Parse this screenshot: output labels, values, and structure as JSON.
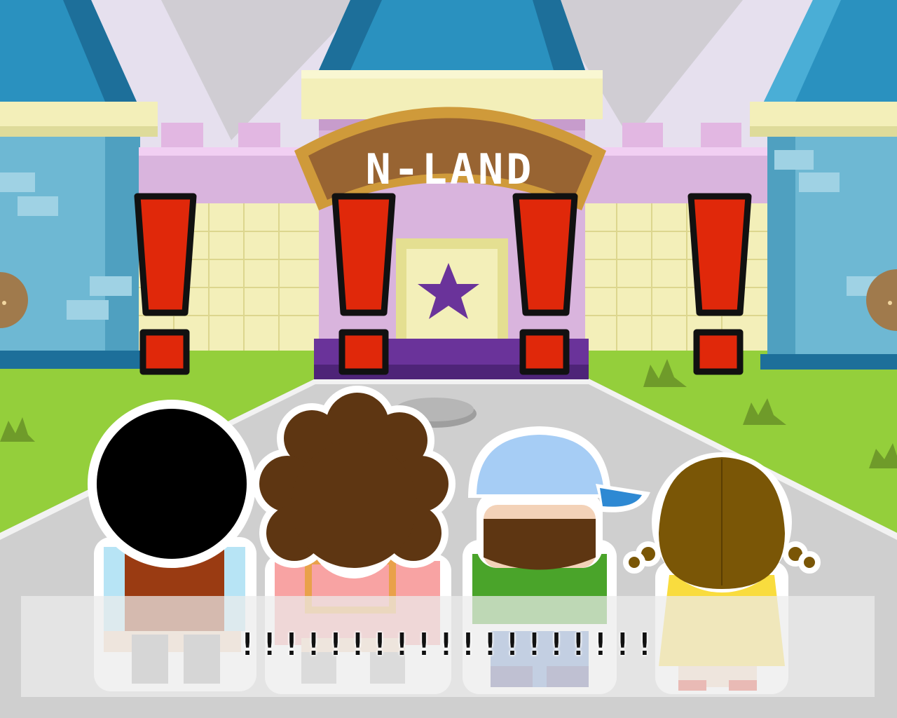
{
  "scene": {
    "sign_text": "N-LAND",
    "exclamation_marks": [
      {
        "id": "alert-1",
        "char": "!"
      },
      {
        "id": "alert-2",
        "char": "!"
      },
      {
        "id": "alert-3",
        "char": "!"
      },
      {
        "id": "alert-4",
        "char": "!"
      }
    ]
  },
  "dialogue": {
    "text": "!!!!!!!!!!!!!!!!!!!"
  },
  "colors": {
    "sky": "#e6e0ee",
    "grass": "#94cf3b",
    "path": "#cfcfcf",
    "tower_blue": "#6eb8d3",
    "roof_blue": "#1a7fb0",
    "wall_pink": "#d9b4dd",
    "wall_cream": "#f3efb9",
    "sign_brown": "#986432",
    "door_purple": "#6a339a",
    "exclamation_red": "#e0280a"
  }
}
